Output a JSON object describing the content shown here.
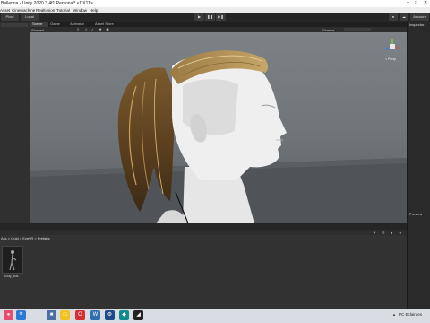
{
  "window": {
    "title": "Ballerina - Unity 2020.3.4f1 Personal* <DX11>"
  },
  "menu": [
    "Asset",
    "Cinemachine",
    "Realtusion",
    "Tutorial",
    "Window",
    "Help"
  ],
  "toolbar": {
    "pivot": "Pivot",
    "local": "Local",
    "account": "Account"
  },
  "tabs": {
    "scene": "Scene",
    "game": "Game",
    "animator": "Animator",
    "asset_store": "Asset Store"
  },
  "scene_toolbar": {
    "mode": "Shaded",
    "gizmos": "Gizmos"
  },
  "gizmo": {
    "persp": "< Persp"
  },
  "right_panel": {
    "inspector_tab": "Inspector",
    "preview_label": "Preview"
  },
  "breadcrumb": {
    "path": "Ass > Gold > Eve9R > Prefabs"
  },
  "asset": {
    "name": "body_Bis"
  },
  "taskbar": {
    "user": "PC Eclairdes"
  },
  "colors": {
    "viewport_bg": "#7c8286",
    "editor_bg": "#2b2b2b",
    "taskbar_bg": "#d9dde3"
  }
}
